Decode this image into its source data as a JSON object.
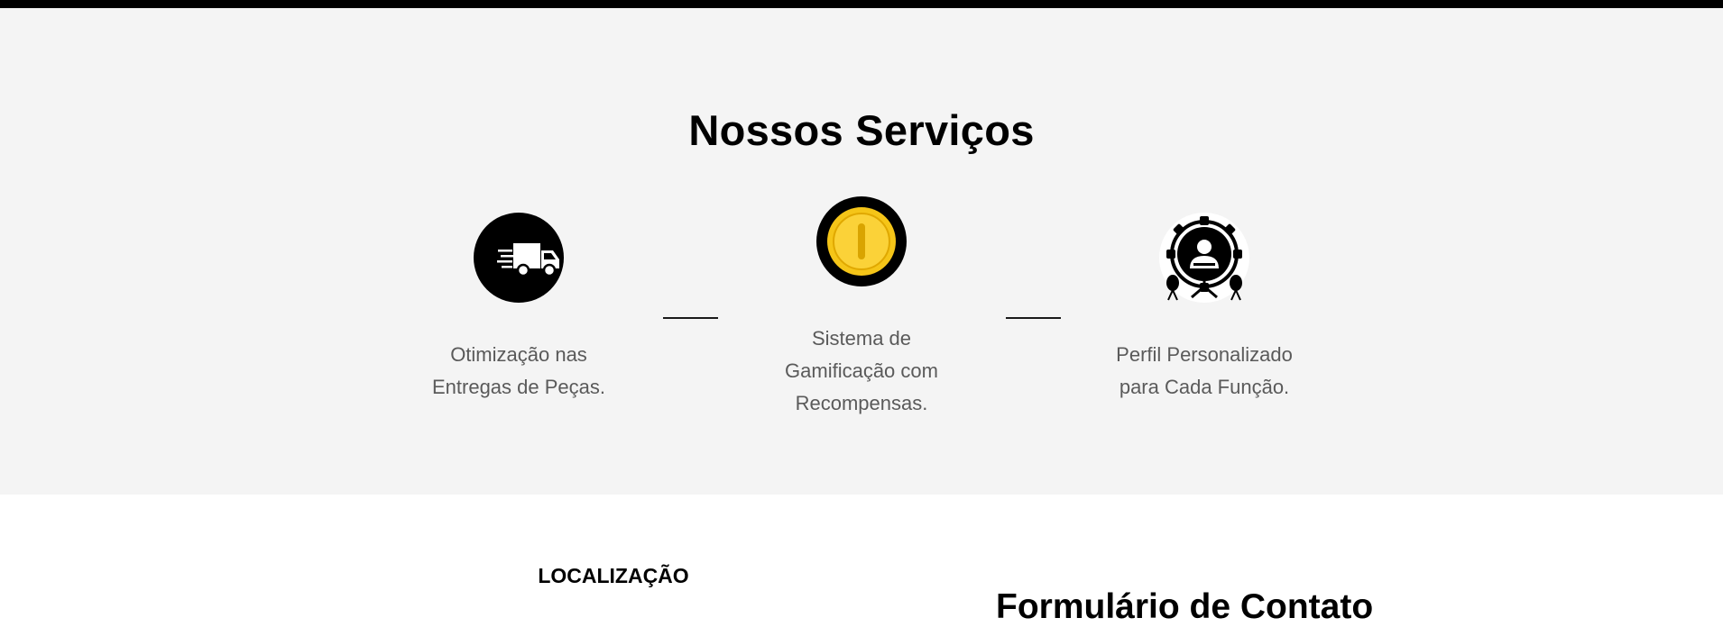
{
  "services": {
    "title": "Nossos Serviços",
    "items": [
      {
        "icon": "delivery-truck-icon",
        "text_line1": "Otimização nas",
        "text_line2": "Entregas de Peças.",
        "text_line3": ""
      },
      {
        "icon": "gold-coin-icon",
        "text_line1": "Sistema de",
        "text_line2": "Gamificação com",
        "text_line3": "Recompensas."
      },
      {
        "icon": "profile-gear-icon",
        "text_line1": "Perfil Personalizado",
        "text_line2": "para Cada Função.",
        "text_line3": ""
      }
    ]
  },
  "location": {
    "heading": "LOCALIZAÇÃO"
  },
  "contact_form": {
    "heading": "Formulário de Contato"
  },
  "colors": {
    "top_bar": "#000000",
    "services_bg": "#f4f4f4",
    "coin_gold": "#f5c518",
    "text_gray": "#5a5a5a"
  }
}
